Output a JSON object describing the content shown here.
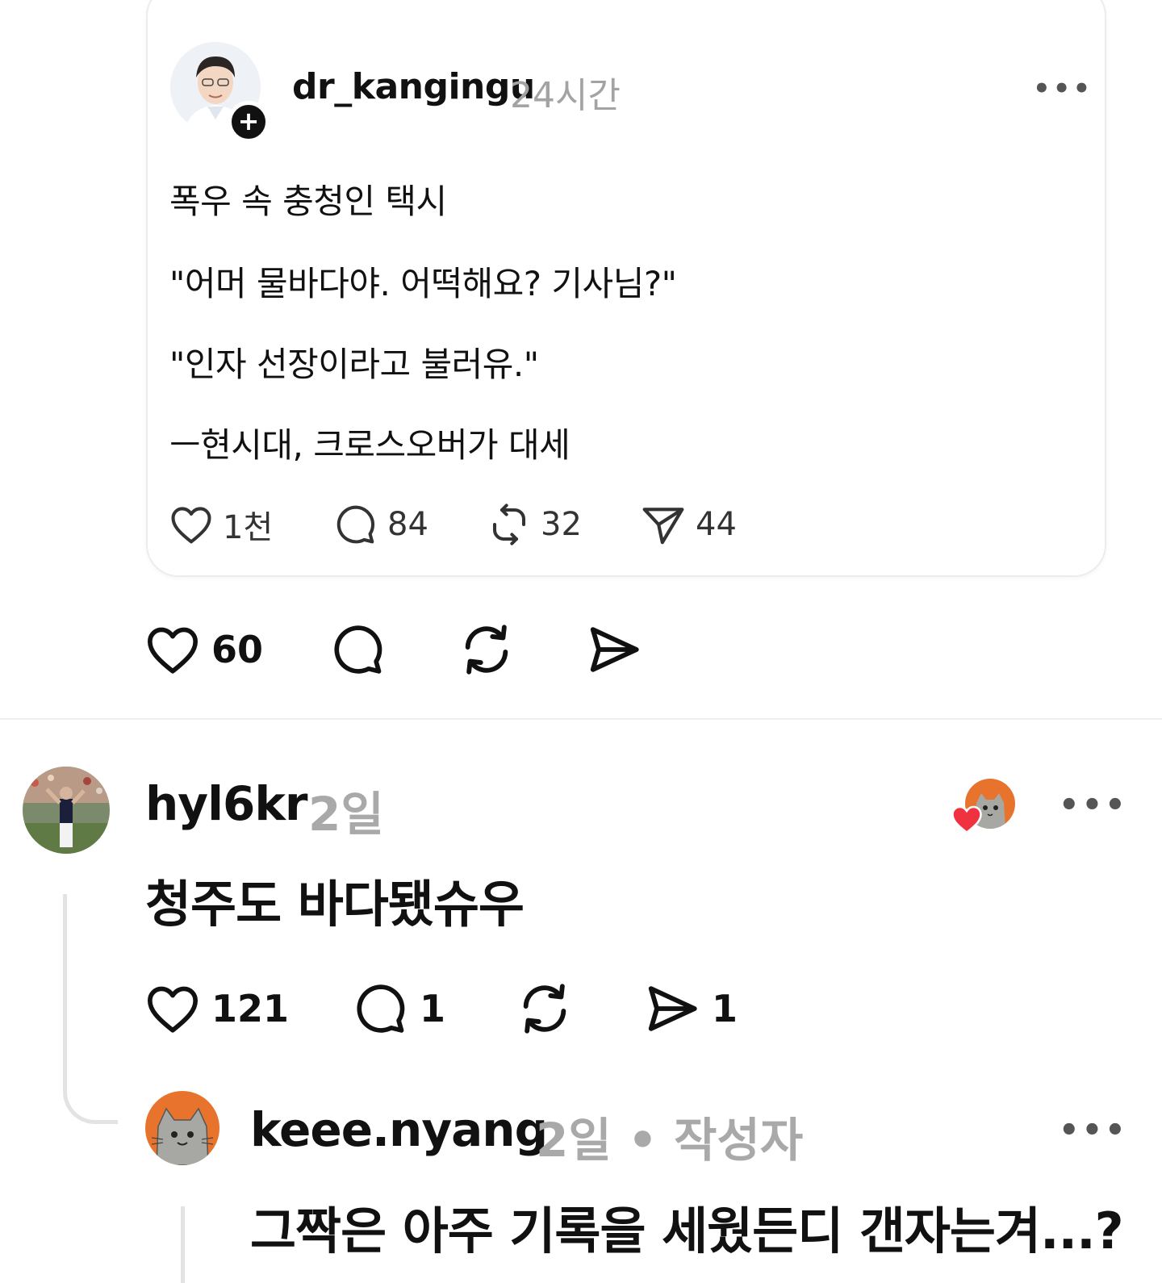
{
  "quoted_post": {
    "username": "dr_kangingu",
    "time": "24시간",
    "more": "•••",
    "follow_badge": "+",
    "lines": [
      "폭우 속 충청인 택시",
      "\"어머 물바다야. 어떡해요? 기사님?\"",
      "\"인자 선장이라고 불러유.\"",
      "ㅡ현시대, 크로스오버가 대세"
    ],
    "stats": {
      "likes": "1천",
      "comments": "84",
      "reposts": "32",
      "shares": "44"
    }
  },
  "post_actions": {
    "likes": "60"
  },
  "reply1": {
    "username": "hyl6kr",
    "time": "2일",
    "more": "•••",
    "text": "청주도 바다됐슈우",
    "stats": {
      "likes": "121",
      "comments": "1",
      "shares": "1"
    }
  },
  "reply2": {
    "username": "keee.nyang",
    "meta": "2일 • 작성자",
    "more": "•••",
    "text": "그짝은 아주 기록을 세웠든디 갠자는겨...?"
  },
  "colors": {
    "text": "#111111",
    "muted": "#a9a9a9",
    "heart_red": "#f0313f",
    "avatar_orange": "#e8732c"
  },
  "icons": [
    "heart-icon",
    "comment-icon",
    "repost-icon",
    "share-icon",
    "more-icon",
    "plus-icon"
  ]
}
